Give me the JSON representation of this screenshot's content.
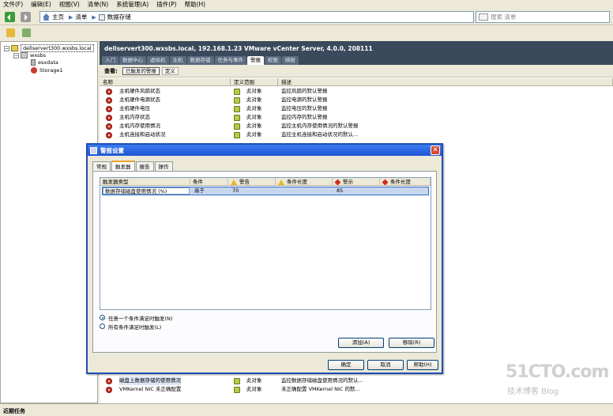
{
  "menu": [
    "文件(F)",
    "编辑(E)",
    "视图(V)",
    "清单(N)",
    "系统管理(A)",
    "插件(P)",
    "帮助(H)"
  ],
  "nav": {
    "home": "主页",
    "inventory": "清单",
    "datastores": "数据存储",
    "search_placeholder": "搜索 清单"
  },
  "tree": {
    "root": "dellservert300.wxsbs.local",
    "datacenter": "wxsbs",
    "items": [
      "esxdata",
      "Storage1"
    ]
  },
  "right": {
    "header": "dellservert300.wxsbs.local, 192.168.1.23 VMware vCenter Server, 4.0.0, 208111",
    "tabs": [
      "入门",
      "数据中心",
      "虚拟机",
      "主机",
      "数据存储",
      "任务与事件",
      "警报",
      "权限",
      "映射"
    ],
    "active_tab_index": 6,
    "view_label": "查看:",
    "view_buttons": [
      "已触发的警报",
      "定义"
    ],
    "columns": [
      "名称",
      "定义范围",
      "描述"
    ],
    "rows_top": [
      {
        "name": "主机硬件风扇状态",
        "scope": "此对象",
        "desc": "监控风扇的默认警报"
      },
      {
        "name": "主机硬件电源状态",
        "scope": "此对象",
        "desc": "监控电源的默认警报"
      },
      {
        "name": "主机硬件电压",
        "scope": "此对象",
        "desc": "监控电压的默认警报"
      },
      {
        "name": "主机内存状态",
        "scope": "此对象",
        "desc": "监控内存的默认警报"
      },
      {
        "name": "主机内存使用情况",
        "scope": "此对象",
        "desc": "监控主机内存使用情况的默认警报"
      },
      {
        "name": "主机连接和启动状况",
        "scope": "此对象",
        "desc": "监控主机连接和启动状况的默认..."
      }
    ],
    "rows_bottom": [
      {
        "name": "磁盘上数据存储的使用情况",
        "scope": "此对象",
        "desc": "监控数据存储磁盘使用情况的默认..."
      },
      {
        "name": "VMKernel NIC 未正确配置",
        "scope": "此对象",
        "desc": "未正确配置 VMKernel NIC 的默..."
      }
    ]
  },
  "status_bar": "近期任务",
  "dialog": {
    "title": "警报设置",
    "close": "✕",
    "tabs": [
      "常规",
      "触发器",
      "报告",
      "操作"
    ],
    "active_tab_index": 1,
    "columns": [
      "触发器类型",
      "条件",
      "警告",
      "条件长度",
      "警示",
      "条件长度"
    ],
    "row": {
      "type": "数据存储磁盘使用情况 (%)",
      "condition": "高于",
      "warning": "70",
      "warn_duration": "",
      "alert": "85",
      "alert_duration": ""
    },
    "radio_any": "任意一个条件满足时触发(N)",
    "radio_all": "所有条件满足时触发(L)",
    "add_button": "添加(A)",
    "remove_button": "移除(R)",
    "ok": "确定",
    "cancel": "取消",
    "help": "帮助(H)"
  },
  "watermark": {
    "site": "51CTO.com",
    "sub": "技术博客  Blog"
  },
  "colors": {
    "header_bg": "#3a4a5c",
    "dialog_title": "#1d55d5",
    "alarm_red": "#cc2e22"
  }
}
